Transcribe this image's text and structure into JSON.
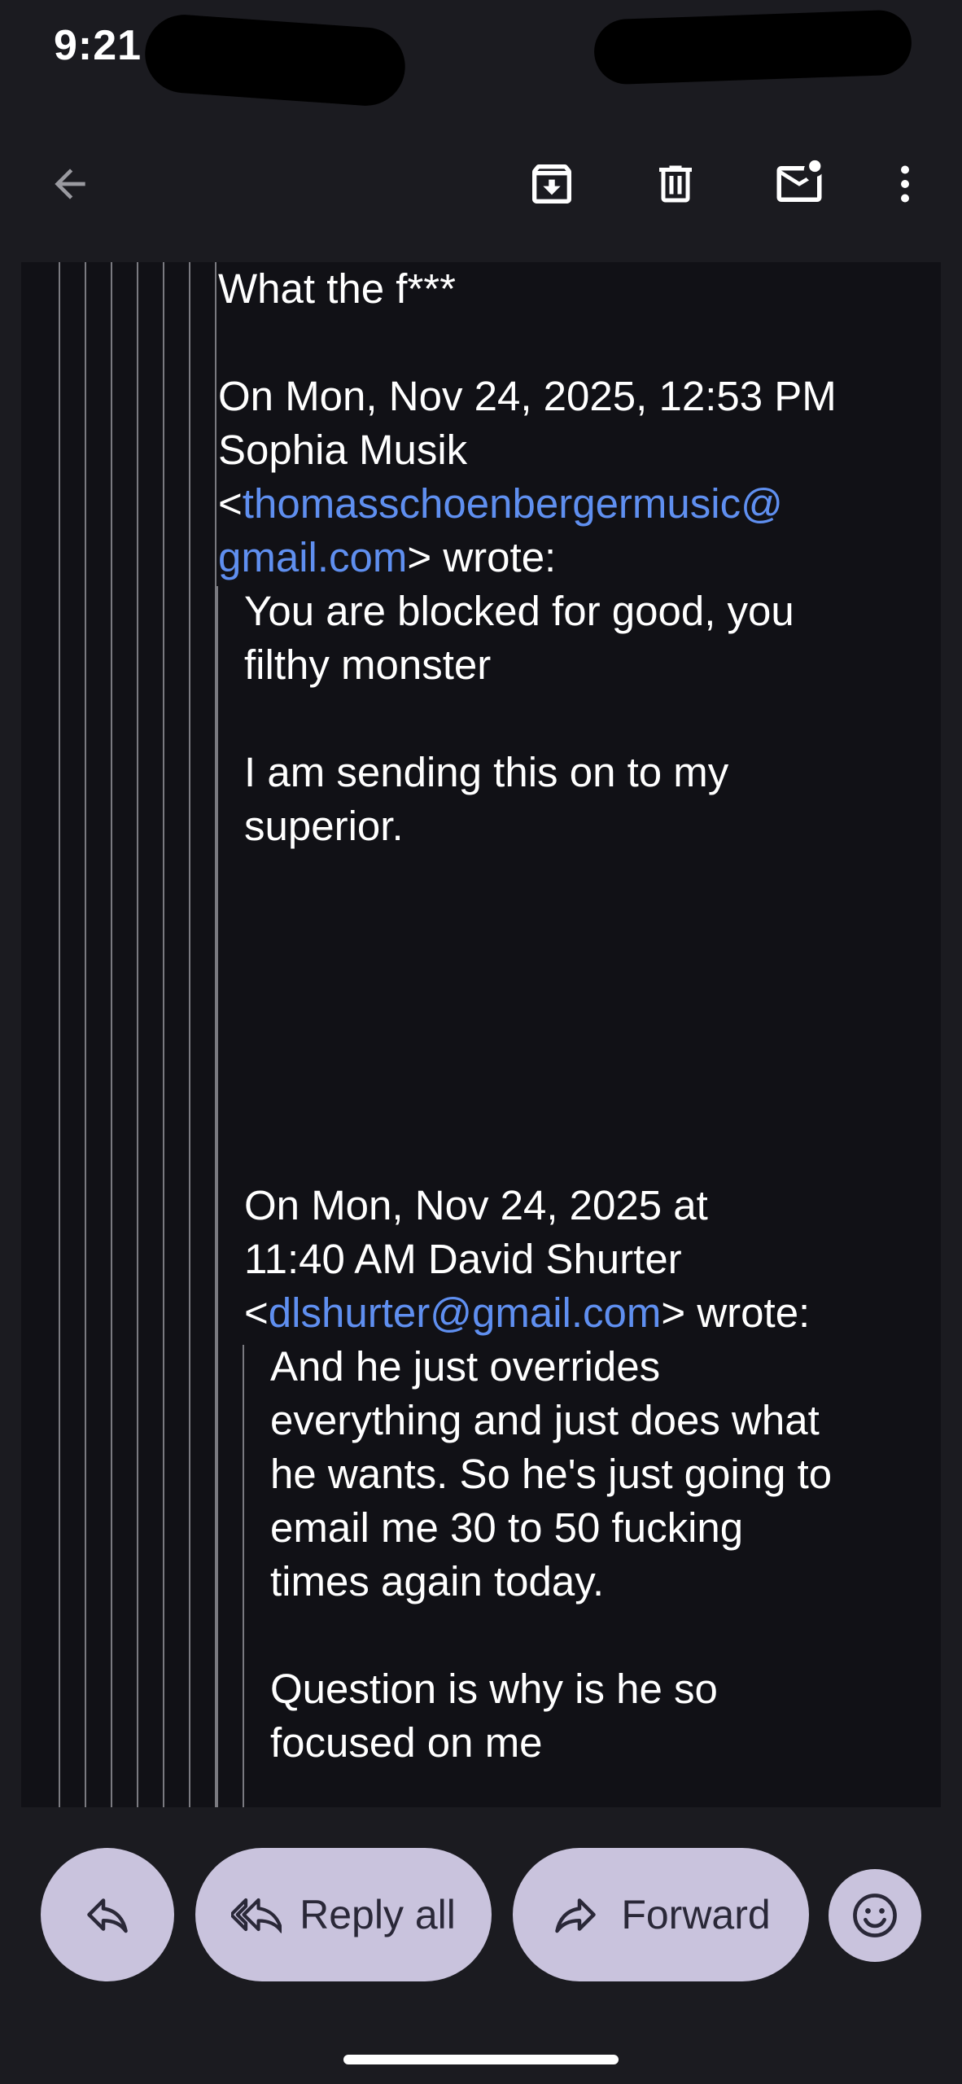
{
  "status_bar": {
    "time": "9:21"
  },
  "toolbar": {
    "back_icon": "arrow-back-icon",
    "archive_icon": "archive-icon",
    "delete_icon": "trash-icon",
    "mark_unread_icon": "mark-unread-icon",
    "more_icon": "more-vertical-icon"
  },
  "email": {
    "top_line": "What the f***",
    "quote1_header": {
      "line1": "On Mon, Nov 24, 2025, 12:53 PM",
      "line2": "Sophia Musik",
      "lt": "<",
      "email_part1": "thomasschoenbergermusic@",
      "email_part2": "gmail.com",
      "wrote": "> wrote:"
    },
    "quote1_body": {
      "line1": "You are blocked for good, you",
      "line2": "filthy monster",
      "line3": "I am sending this on to my",
      "line4": "superior."
    },
    "quote2_header": {
      "line1": "On Mon, Nov 24, 2025 at",
      "line2": "11:40 AM David Shurter",
      "lt": "<",
      "email": "dlshurter@gmail.com",
      "wrote": "> wrote:"
    },
    "quote2_body": {
      "line1": "And he just overrides",
      "line2": "everything and just does what",
      "line3": "he wants. So he's just going to",
      "line4": "email me 30 to 50 fucking",
      "line5": "times again today.",
      "line6": "Question is why is he so",
      "line7": "focused on me"
    }
  },
  "actions": {
    "reply_icon": "reply-icon",
    "reply_all_label": "Reply all",
    "reply_all_icon": "reply-all-icon",
    "forward_label": "Forward",
    "forward_icon": "forward-icon",
    "emoji_icon": "emoji-smile-icon"
  },
  "colors": {
    "background": "#1b1b20",
    "email_background": "#111116",
    "link": "#5f8ff0",
    "pill": "#c9c3dd",
    "pill_text": "#2a2838"
  }
}
